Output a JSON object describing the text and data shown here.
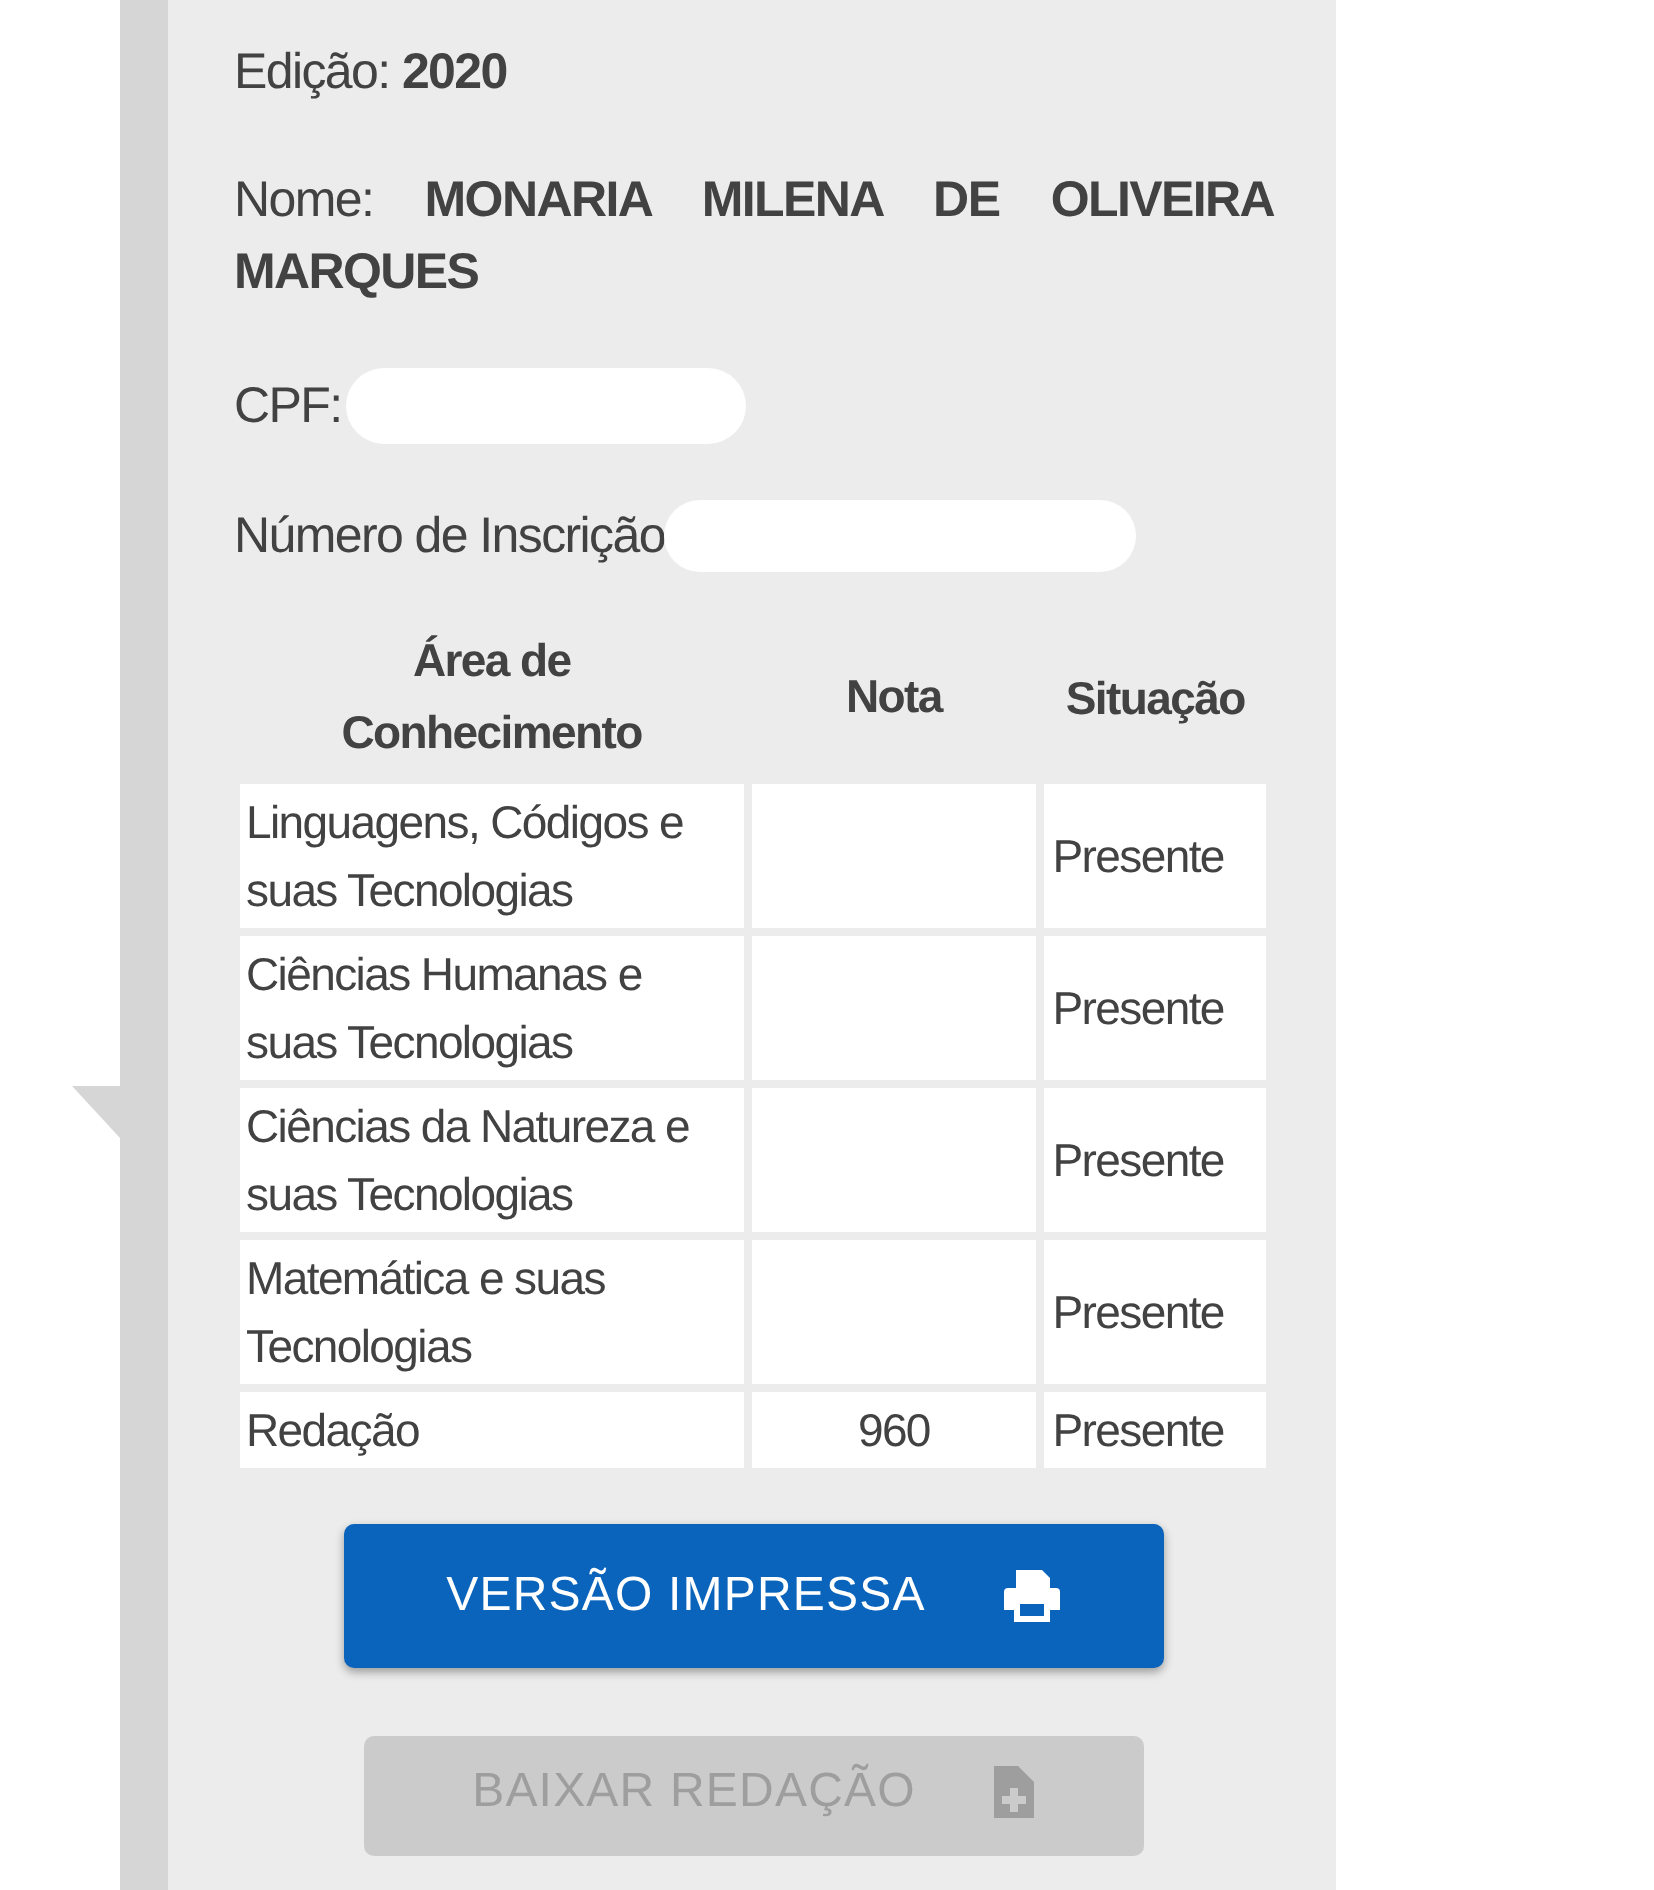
{
  "edicao": {
    "label": "Edição:",
    "value": "2020"
  },
  "nome": {
    "label": "Nome:",
    "value": "MONARIA MILENA DE OLIVEIRA MARQUES"
  },
  "cpf": {
    "label": "CPF:",
    "redacted": true
  },
  "inscricao": {
    "label": "Número de Inscrição",
    "redacted": true
  },
  "table": {
    "columns": [
      "Área de Conhecimento",
      "Nota",
      "Situação"
    ],
    "rows": [
      {
        "area": "Linguagens, Códigos e suas Tecnologias",
        "situacao": "Presente"
      },
      {
        "area": "Ciências Humanas e suas Tecnologias",
        "situacao": "Presente"
      },
      {
        "area": "Ciências da Natureza e suas Tecnologias",
        "situacao": "Presente"
      },
      {
        "area": "Matemática e suas Tecnologias",
        "situacao": "Presente"
      },
      {
        "area": "Redação",
        "nota": "960",
        "situacao": "Presente"
      }
    ]
  },
  "buttons": [
    {
      "label": "VERSÃO IMPRESSA",
      "kind": "print",
      "disabled": false
    },
    {
      "label": "BAIXAR REDAÇÃO",
      "kind": "download",
      "disabled": true
    }
  ]
}
